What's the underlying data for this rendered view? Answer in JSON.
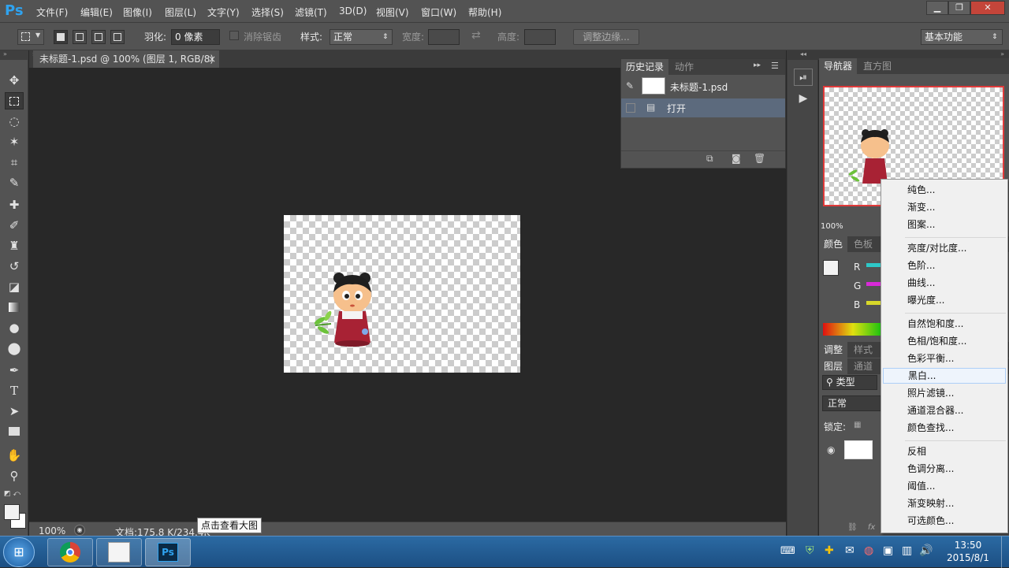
{
  "app": {
    "logo": "Ps"
  },
  "menu": {
    "items": [
      "文件(F)",
      "编辑(E)",
      "图像(I)",
      "图层(L)",
      "文字(Y)",
      "选择(S)",
      "滤镜(T)",
      "3D(D)",
      "视图(V)",
      "窗口(W)",
      "帮助(H)"
    ]
  },
  "window_controls": {
    "minimize": "▁",
    "restore": "❐",
    "close": "✕"
  },
  "options": {
    "feather_label": "羽化:",
    "feather_value": "0 像素",
    "antialias_label": "消除锯齿",
    "style_label": "样式:",
    "style_value": "正常",
    "width_label": "宽度:",
    "height_label": "高度:",
    "refine_edge": "调整边缘...",
    "workspace": "基本功能"
  },
  "document": {
    "tab_title": "未标题-1.psd @ 100% (图层 1, RGB/8)",
    "close_glyph": "×"
  },
  "status": {
    "zoom": "100%",
    "doc_info": "文档:175.8 K/234.4K",
    "tooltip": "点击查看大图"
  },
  "history_panel": {
    "tabs": [
      "历史记录",
      "动作"
    ],
    "snapshot_name": "未标题-1.psd",
    "steps": [
      "打开"
    ]
  },
  "right_panels": {
    "navigator_tabs": [
      "导航器",
      "直方图"
    ],
    "nav_zoom": "100%",
    "color_tabs": [
      "颜色",
      "色板"
    ],
    "channels": [
      "R",
      "G",
      "B"
    ],
    "adjust_tabs": [
      "调整",
      "样式"
    ],
    "layers_tabs": [
      "图层",
      "通道"
    ],
    "kind_label": "类型",
    "blend_mode": "正常",
    "lock_label": "锁定:"
  },
  "context_menu": {
    "group1": [
      "纯色...",
      "渐变...",
      "图案..."
    ],
    "group2": [
      "亮度/对比度...",
      "色阶...",
      "曲线...",
      "曝光度..."
    ],
    "group3": [
      "自然饱和度...",
      "色相/饱和度...",
      "色彩平衡...",
      "黑白...",
      "照片滤镜...",
      "通道混合器...",
      "颜色查找..."
    ],
    "group4": [
      "反相",
      "色调分离...",
      "阈值...",
      "渐变映射...",
      "可选颜色..."
    ],
    "highlighted": "黑白..."
  },
  "taskbar": {
    "time": "13:50",
    "date": "2015/8/1"
  },
  "colors": {
    "ui_dark": "#535353",
    "canvas_bg": "#282828",
    "ps_blue": "#2fa3f0",
    "nav_border": "#e03a3a",
    "taskbar": "#1c4f83"
  }
}
